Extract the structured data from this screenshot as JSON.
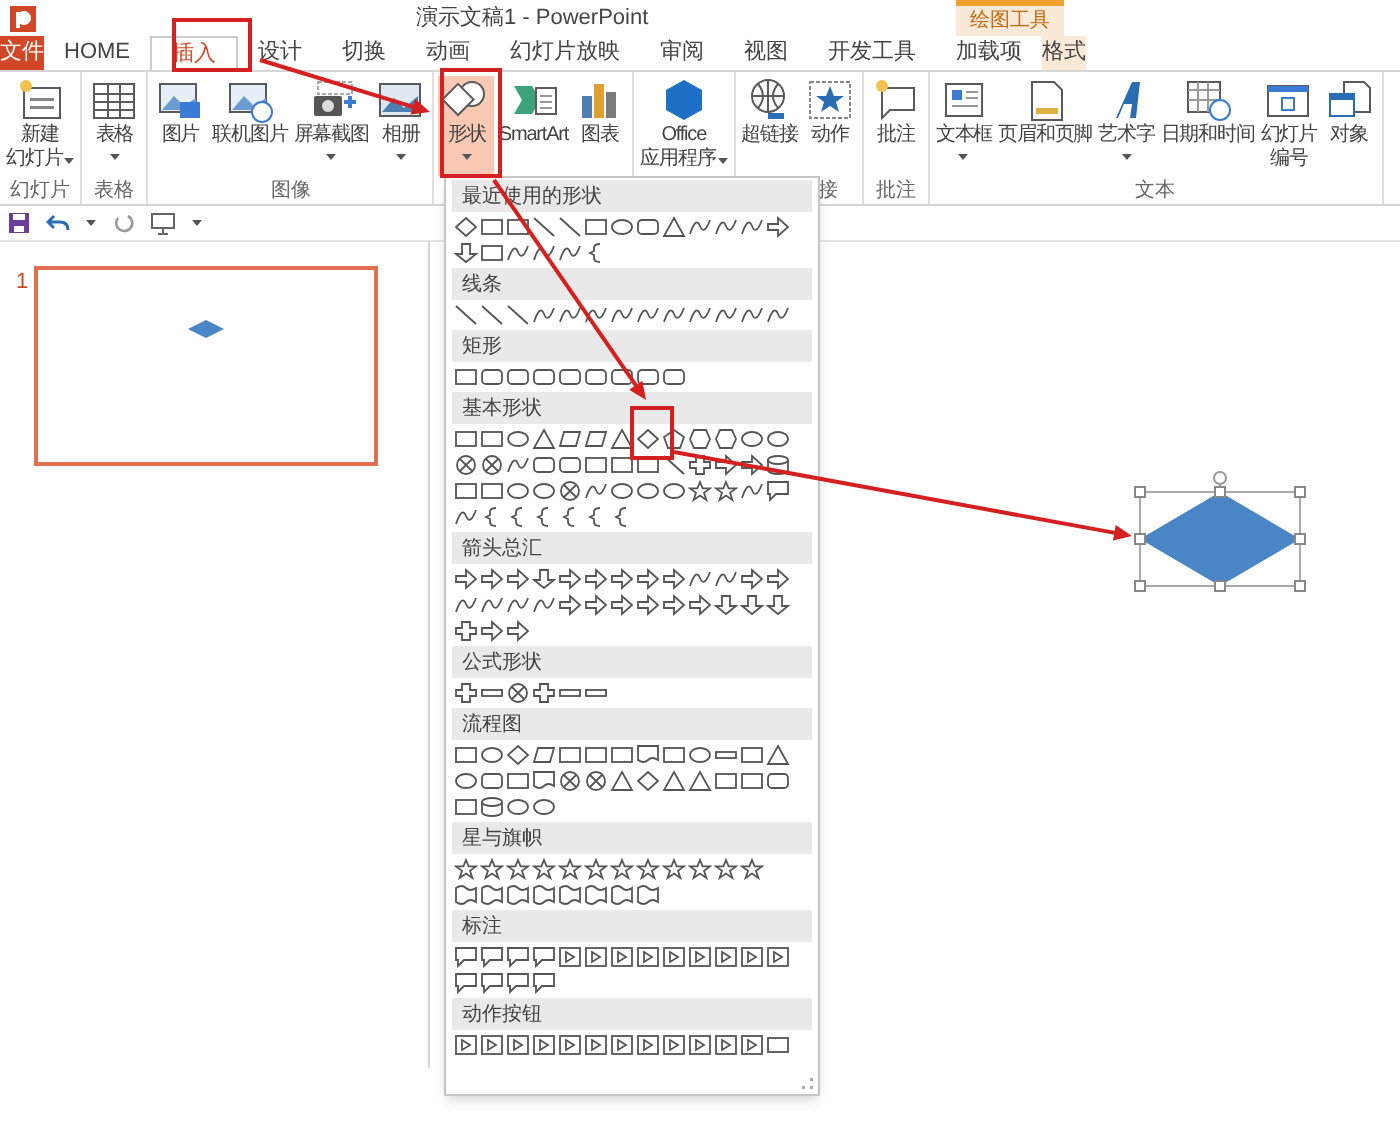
{
  "title_bar": {
    "title": "演示文稿1 - PowerPoint",
    "context_group": "绘图工具"
  },
  "tabs": [
    {
      "label": "文件",
      "kind": "file",
      "selected": false
    },
    {
      "label": "HOME",
      "kind": "normal",
      "selected": false
    },
    {
      "label": "插入",
      "kind": "normal",
      "selected": true
    },
    {
      "label": "设计",
      "kind": "normal",
      "selected": false
    },
    {
      "label": "切换",
      "kind": "normal",
      "selected": false
    },
    {
      "label": "动画",
      "kind": "normal",
      "selected": false
    },
    {
      "label": "幻灯片放映",
      "kind": "normal",
      "selected": false
    },
    {
      "label": "审阅",
      "kind": "normal",
      "selected": false
    },
    {
      "label": "视图",
      "kind": "normal",
      "selected": false
    },
    {
      "label": "开发工具",
      "kind": "normal",
      "selected": false
    },
    {
      "label": "加载项",
      "kind": "normal",
      "selected": false
    },
    {
      "label": "格式",
      "kind": "contextual",
      "selected": false
    }
  ],
  "ribbon_groups": [
    {
      "label": "幻灯片",
      "buttons": [
        {
          "lines": [
            "新建",
            "幻灯片"
          ],
          "dropdown": true,
          "pressed": false
        }
      ]
    },
    {
      "label": "表格",
      "buttons": [
        {
          "lines": [
            "表格"
          ],
          "dropdown": true,
          "pressed": false
        }
      ]
    },
    {
      "label": "图像",
      "buttons": [
        {
          "lines": [
            "图片"
          ],
          "dropdown": false,
          "pressed": false
        },
        {
          "lines": [
            "联机图片"
          ],
          "dropdown": false,
          "pressed": false
        },
        {
          "lines": [
            "屏幕截图"
          ],
          "dropdown": true,
          "pressed": false
        },
        {
          "lines": [
            "相册"
          ],
          "dropdown": true,
          "pressed": false
        }
      ]
    },
    {
      "buttons": [
        {
          "lines": [
            "形状"
          ],
          "dropdown": true,
          "pressed": true
        },
        {
          "lines": [
            "SmartArt"
          ],
          "dropdown": false,
          "pressed": false
        },
        {
          "lines": [
            "图表"
          ],
          "dropdown": false,
          "pressed": false
        }
      ]
    },
    {
      "buttons": [
        {
          "lines": [
            "Office",
            "应用程序"
          ],
          "dropdown": true,
          "pressed": false
        }
      ]
    },
    {
      "label": "接",
      "buttons": [
        {
          "lines": [
            "超链接"
          ],
          "dropdown": false,
          "pressed": false
        },
        {
          "lines": [
            "动作"
          ],
          "dropdown": false,
          "pressed": false
        }
      ]
    },
    {
      "label": "批注",
      "buttons": [
        {
          "lines": [
            "批注"
          ],
          "dropdown": false,
          "pressed": false
        }
      ]
    },
    {
      "label": "文本",
      "buttons": [
        {
          "lines": [
            "文本框"
          ],
          "dropdown": true,
          "pressed": false
        },
        {
          "lines": [
            "页眉和页脚"
          ],
          "dropdown": false,
          "pressed": false
        },
        {
          "lines": [
            "艺术字"
          ],
          "dropdown": true,
          "pressed": false
        },
        {
          "lines": [
            "日期和时间"
          ],
          "dropdown": false,
          "pressed": false
        },
        {
          "lines": [
            "幻灯片",
            "编号"
          ],
          "dropdown": false,
          "pressed": false
        },
        {
          "lines": [
            "对象"
          ],
          "dropdown": false,
          "pressed": false
        }
      ]
    }
  ],
  "shapes_gallery": {
    "sections": [
      {
        "title": "最近使用的形状"
      },
      {
        "title": "线条"
      },
      {
        "title": "矩形"
      },
      {
        "title": "基本形状"
      },
      {
        "title": "箭头总汇"
      },
      {
        "title": "公式形状"
      },
      {
        "title": "流程图"
      },
      {
        "title": "星与旗帜"
      },
      {
        "title": "标注"
      },
      {
        "title": "动作按钮"
      }
    ]
  },
  "slides_pane": {
    "slides": [
      {
        "number": "1",
        "selected": true
      }
    ]
  }
}
